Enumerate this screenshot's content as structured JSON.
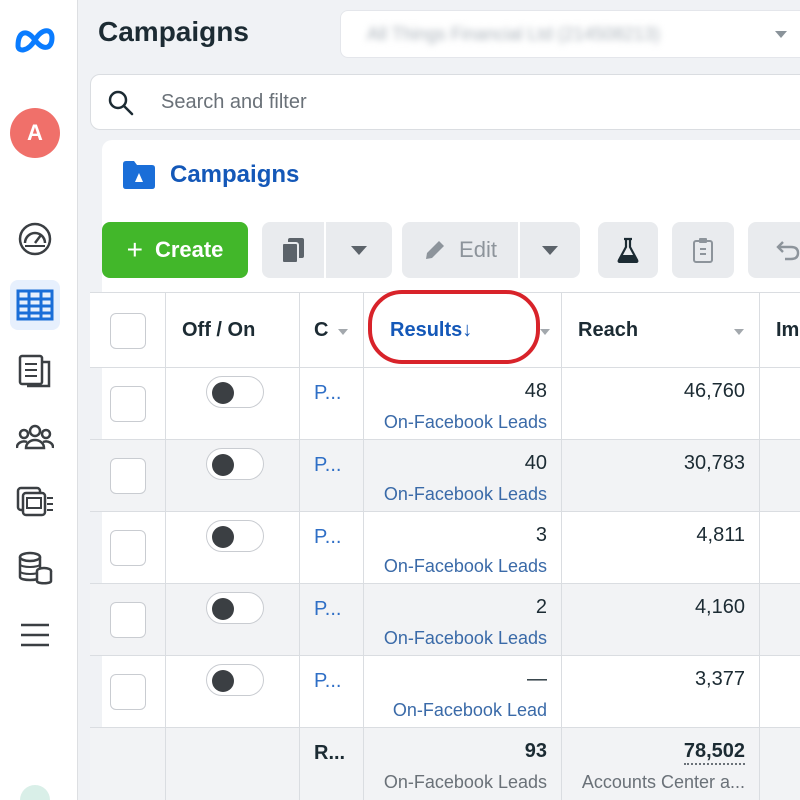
{
  "nav": {
    "avatar_letter": "A",
    "items": [
      {
        "name": "dashboard-icon"
      },
      {
        "name": "campaigns-table-icon",
        "active": true
      },
      {
        "name": "reports-icon"
      },
      {
        "name": "audiences-icon"
      },
      {
        "name": "ads-library-icon"
      },
      {
        "name": "billing-icon"
      },
      {
        "name": "menu-icon"
      }
    ]
  },
  "header": {
    "title": "Campaigns",
    "account_selector": "All Things Financial Ltd (214508213)"
  },
  "search": {
    "placeholder": "Search and filter"
  },
  "panel": {
    "tab_label": "Campaigns",
    "toolbar": {
      "create_label": "Create",
      "edit_label": "Edit"
    }
  },
  "table": {
    "headers": {
      "toggle": "Off / On",
      "name": "C",
      "results": "Results",
      "results_sort": "↓",
      "reach": "Reach",
      "impressions": "Im"
    },
    "rows": [
      {
        "name": "P...",
        "results": "48",
        "result_type": "On-Facebook Leads",
        "reach": "46,760"
      },
      {
        "name": "P...",
        "results": "40",
        "result_type": "On-Facebook Leads",
        "reach": "30,783"
      },
      {
        "name": "P...",
        "results": "3",
        "result_type": "On-Facebook Leads",
        "reach": "4,811"
      },
      {
        "name": "P...",
        "results": "2",
        "result_type": "On-Facebook Leads",
        "reach": "4,160"
      },
      {
        "name": "P...",
        "results": "—",
        "result_type": "On-Facebook Lead",
        "reach": "3,377"
      }
    ],
    "totals": {
      "name": "R...",
      "results": "93",
      "result_type": "On-Facebook Leads",
      "reach": "78,502",
      "reach_sub": "Accounts Center a..."
    }
  },
  "colors": {
    "accent_blue": "#1458b8",
    "create_green": "#42b72a",
    "highlight_red": "#d8232a"
  }
}
